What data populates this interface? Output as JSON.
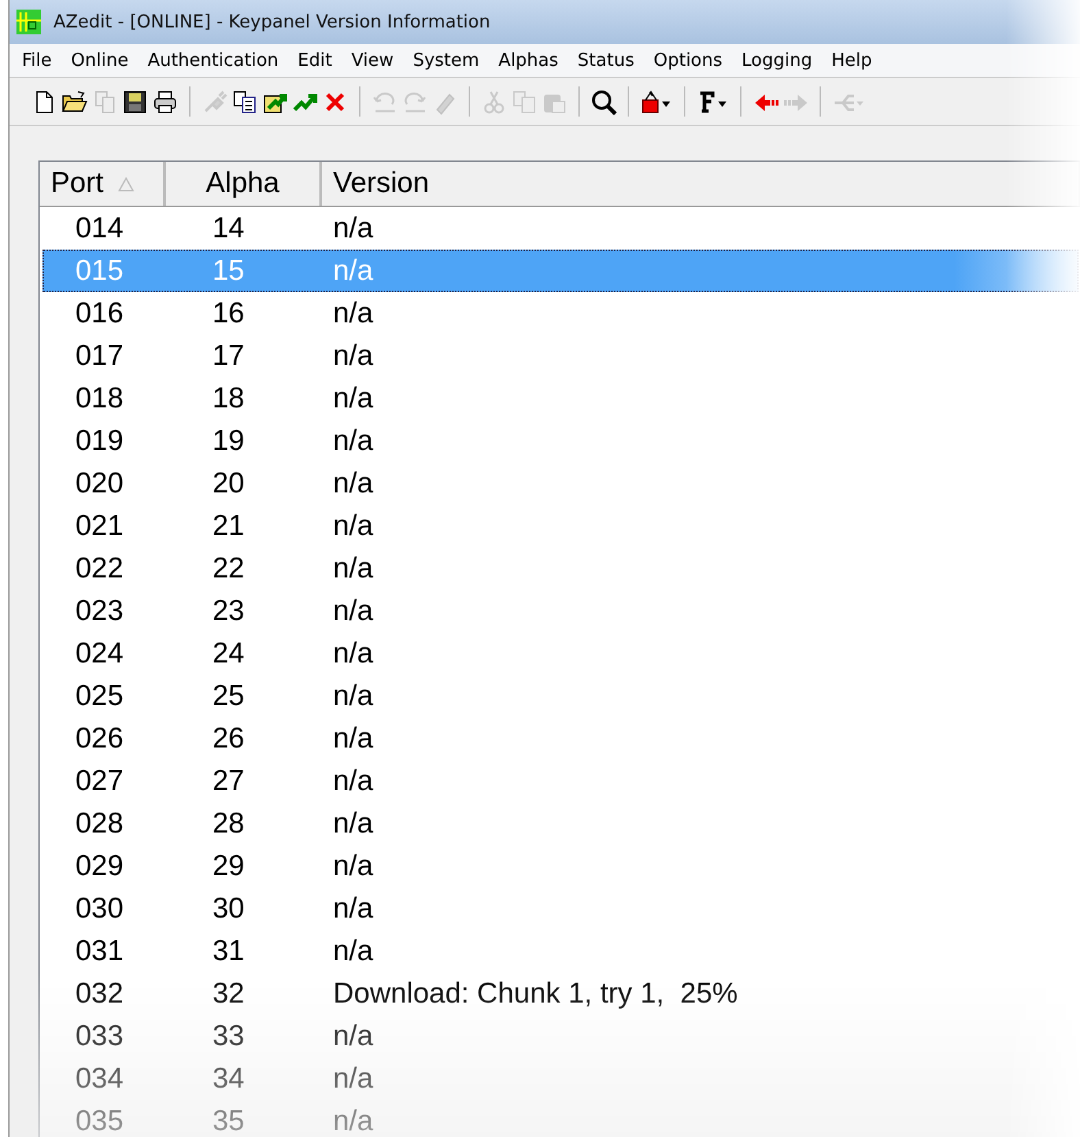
{
  "window": {
    "title": "AZedit - [ONLINE] - Keypanel Version Information"
  },
  "menu": [
    "File",
    "Online",
    "Authentication",
    "Edit",
    "View",
    "System",
    "Alphas",
    "Status",
    "Options",
    "Logging",
    "Help"
  ],
  "toolbar": [
    {
      "disabled": false
    },
    {
      "disabled": false
    },
    {
      "disabled": true
    },
    {
      "disabled": false
    },
    {
      "disabled": false
    },
    {
      "disabled": true
    },
    {
      "disabled": false
    },
    {
      "disabled": false
    },
    {
      "disabled": false
    },
    {
      "disabled": false
    },
    {
      "disabled": true
    },
    {
      "disabled": true
    },
    {
      "disabled": true
    },
    {
      "disabled": true
    },
    {
      "disabled": true
    },
    {
      "disabled": true
    },
    {
      "disabled": false
    },
    {
      "disabled": false
    },
    {
      "disabled": false
    },
    {
      "disabled": false
    },
    {
      "disabled": true
    },
    {
      "disabled": true
    }
  ],
  "table": {
    "columns": [
      {
        "label": "Port",
        "sorted_ascending": true
      },
      {
        "label": "Alpha"
      },
      {
        "label": "Version"
      }
    ],
    "rows": [
      {
        "port": "014",
        "alpha": "14",
        "version": "n/a",
        "selected": false
      },
      {
        "port": "015",
        "alpha": "15",
        "version": "n/a",
        "selected": true
      },
      {
        "port": "016",
        "alpha": "16",
        "version": "n/a",
        "selected": false
      },
      {
        "port": "017",
        "alpha": "17",
        "version": "n/a",
        "selected": false
      },
      {
        "port": "018",
        "alpha": "18",
        "version": "n/a",
        "selected": false
      },
      {
        "port": "019",
        "alpha": "19",
        "version": "n/a",
        "selected": false
      },
      {
        "port": "020",
        "alpha": "20",
        "version": "n/a",
        "selected": false
      },
      {
        "port": "021",
        "alpha": "21",
        "version": "n/a",
        "selected": false
      },
      {
        "port": "022",
        "alpha": "22",
        "version": "n/a",
        "selected": false
      },
      {
        "port": "023",
        "alpha": "23",
        "version": "n/a",
        "selected": false
      },
      {
        "port": "024",
        "alpha": "24",
        "version": "n/a",
        "selected": false
      },
      {
        "port": "025",
        "alpha": "25",
        "version": "n/a",
        "selected": false
      },
      {
        "port": "026",
        "alpha": "26",
        "version": "n/a",
        "selected": false
      },
      {
        "port": "027",
        "alpha": "27",
        "version": "n/a",
        "selected": false
      },
      {
        "port": "028",
        "alpha": "28",
        "version": "n/a",
        "selected": false
      },
      {
        "port": "029",
        "alpha": "29",
        "version": "n/a",
        "selected": false
      },
      {
        "port": "030",
        "alpha": "30",
        "version": "n/a",
        "selected": false
      },
      {
        "port": "031",
        "alpha": "31",
        "version": "n/a",
        "selected": false
      },
      {
        "port": "032",
        "alpha": "32",
        "version": "Download: Chunk 1, try 1,  25%",
        "selected": false
      },
      {
        "port": "033",
        "alpha": "33",
        "version": "n/a",
        "selected": false
      },
      {
        "port": "034",
        "alpha": "34",
        "version": "n/a",
        "selected": false
      },
      {
        "port": "035",
        "alpha": "35",
        "version": "n/a",
        "selected": false
      }
    ]
  }
}
